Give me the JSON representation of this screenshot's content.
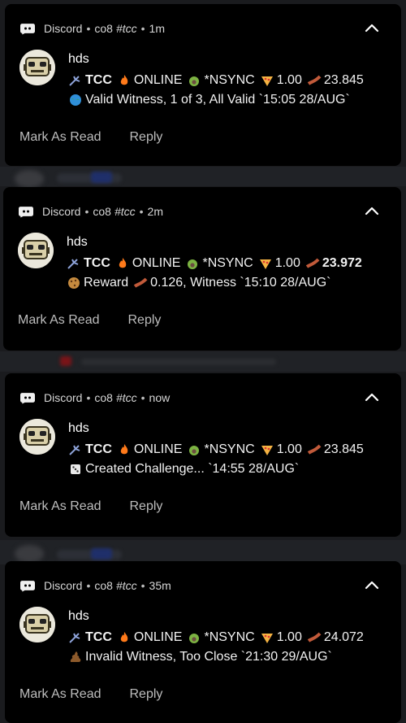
{
  "notifications": [
    {
      "app": "Discord",
      "server": "co8",
      "channel": "#tcc",
      "time": "1m",
      "sender": "hds",
      "tcc": "TCC",
      "online": "ONLINE",
      "nsync": "*NSYNC",
      "pizza_value": "1.00",
      "bacon_value": "23.845",
      "bacon_bold": false,
      "message_icon": "globe-icon",
      "message": "Valid Witness, 1 of 3, All Valid  `15:05 28/AUG`",
      "mark_read": "Mark As Read",
      "reply": "Reply"
    },
    {
      "app": "Discord",
      "server": "co8",
      "channel": "#tcc",
      "time": "2m",
      "sender": "hds",
      "tcc": "TCC",
      "online": "ONLINE",
      "nsync": "*NSYNC",
      "pizza_value": "1.00",
      "bacon_value": "23.972",
      "bacon_bold": true,
      "message_icon": "cookie-icon",
      "message_prefix": "Reward",
      "message_value": "0.126, Witness  `15:10 28/AUG`",
      "mark_read": "Mark As Read",
      "reply": "Reply"
    },
    {
      "app": "Discord",
      "server": "co8",
      "channel": "#tcc",
      "time": "now",
      "sender": "hds",
      "tcc": "TCC",
      "online": "ONLINE",
      "nsync": "*NSYNC",
      "pizza_value": "1.00",
      "bacon_value": "23.845",
      "bacon_bold": false,
      "message_icon": "dice-icon",
      "message": "Created Challenge...  `14:55 28/AUG`",
      "mark_read": "Mark As Read",
      "reply": "Reply"
    },
    {
      "app": "Discord",
      "server": "co8",
      "channel": "#tcc",
      "time": "35m",
      "sender": "hds",
      "tcc": "TCC",
      "online": "ONLINE",
      "nsync": "*NSYNC",
      "pizza_value": "1.00",
      "bacon_value": "24.072",
      "bacon_bold": false,
      "message_icon": "poop-icon",
      "message": "Invalid Witness, Too Close  `21:30 29/AUG`",
      "mark_read": "Mark As Read",
      "reply": "Reply"
    }
  ],
  "colors": {
    "card": "#000000",
    "background": "#1a1b1e",
    "secondary_text": "#bdbdbd"
  }
}
